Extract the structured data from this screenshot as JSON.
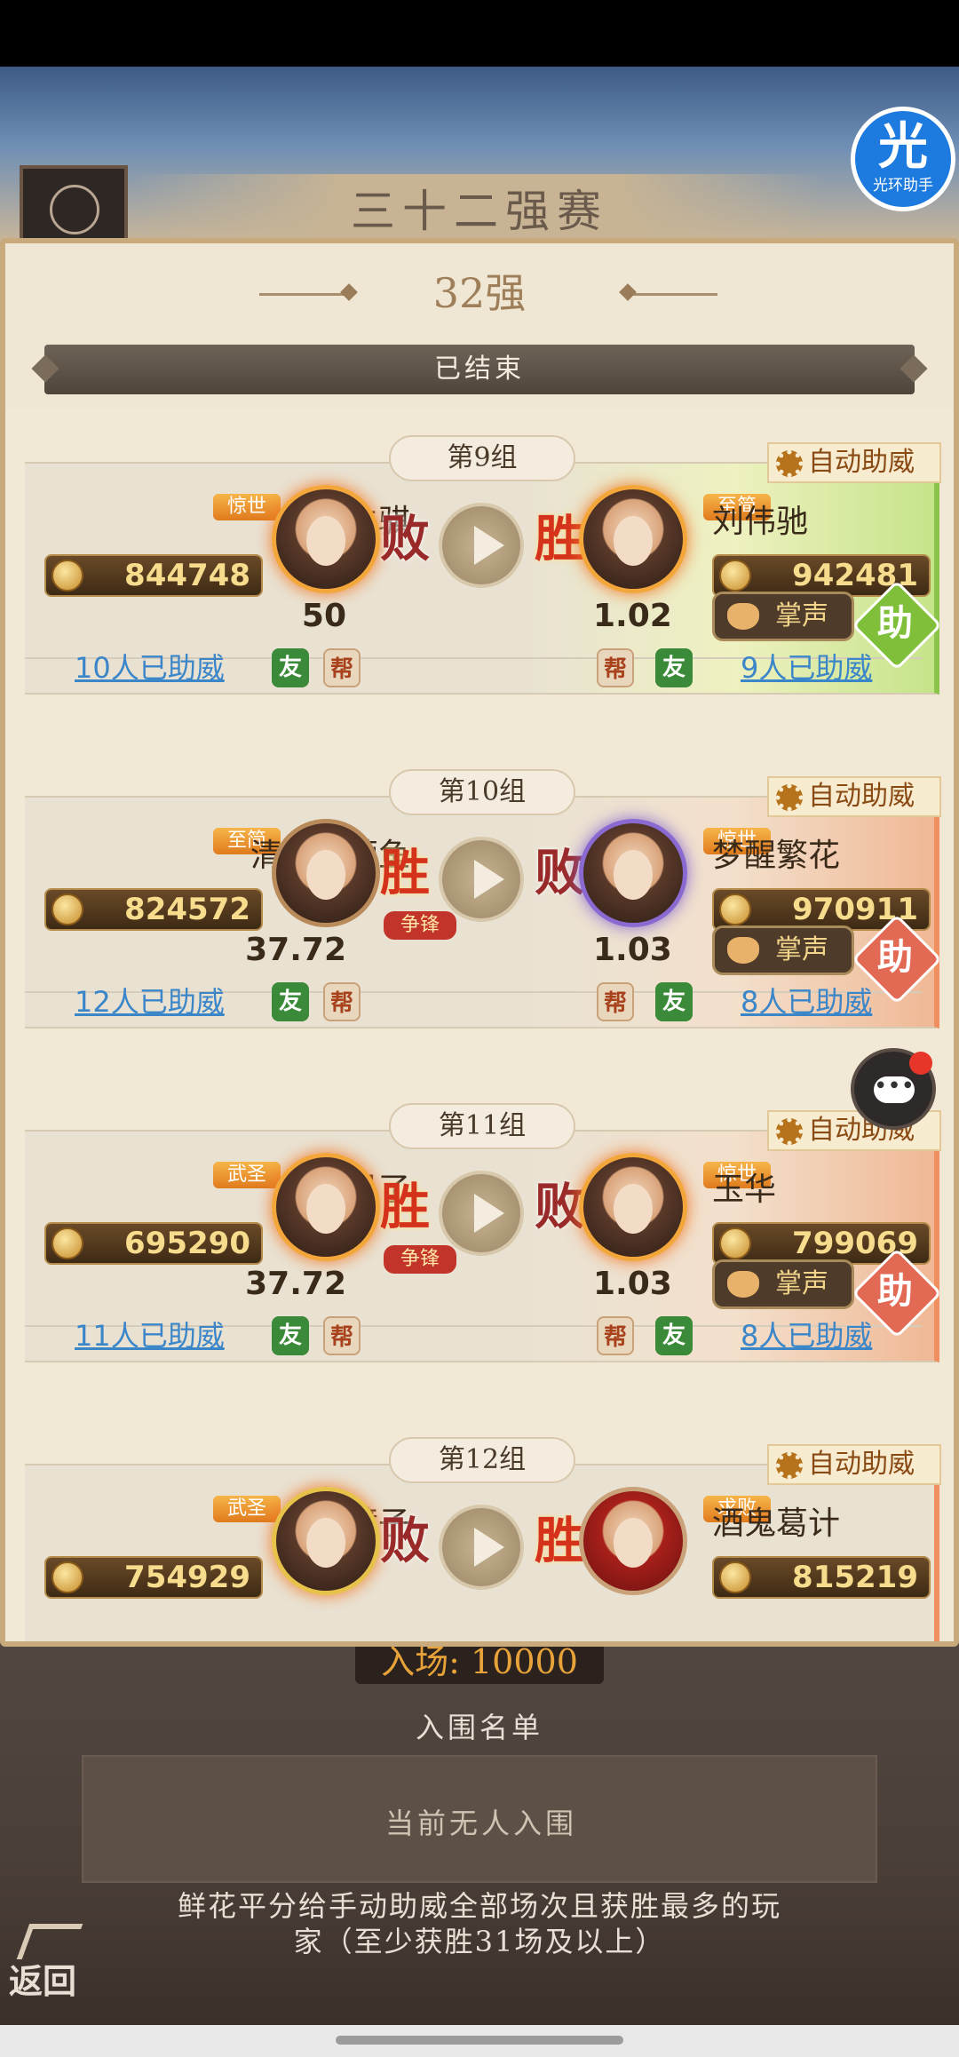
{
  "outer_title": "三十二强赛",
  "badge": {
    "big": "光",
    "small": "光环助手"
  },
  "round_title": "32强",
  "status": "已结束",
  "groups": [
    {
      "label": "第9组",
      "auto_assist": "自动助威",
      "left": {
        "title": "惊世",
        "name": "酒仙牛骐",
        "power": "844748",
        "result": "败",
        "odds": "50",
        "supporters": "10人已助威"
      },
      "right": {
        "title": "至简",
        "name": "刘伟驰",
        "power": "942481",
        "result": "胜",
        "odds": "1.02",
        "supporters": "9人已助威"
      },
      "applause": "掌声",
      "assist": "助"
    },
    {
      "label": "第10组",
      "auto_assist": "自动助威",
      "left": {
        "title": "至简",
        "name": "清花芙蓉鱼",
        "power": "824572",
        "result": "胜",
        "odds": "37.72",
        "supporters": "12人已助威"
      },
      "right": {
        "title": "惊世",
        "name": "梦醒繁花",
        "power": "970911",
        "result": "败",
        "odds": "1.03",
        "supporters": "8人已助威"
      },
      "vanguard": "争锋",
      "applause": "掌声",
      "assist": "助"
    },
    {
      "label": "第11组",
      "auto_assist": "自动助威",
      "left": {
        "title": "武圣",
        "name": "起风了",
        "power": "695290",
        "result": "胜",
        "odds": "37.72",
        "supporters": "11人已助威"
      },
      "right": {
        "title": "惊世",
        "name": "玉华",
        "power": "799069",
        "result": "败",
        "odds": "1.03",
        "supporters": "8人已助威"
      },
      "vanguard": "争锋",
      "applause": "掌声",
      "assist": "助"
    },
    {
      "label": "第12组",
      "auto_assist": "自动助威",
      "left": {
        "title": "武圣",
        "name": "冰镜子",
        "power": "754929",
        "result": "败"
      },
      "right": {
        "title": "求败",
        "name": "酒鬼葛计",
        "power": "815219",
        "result": "胜"
      }
    }
  ],
  "tags": {
    "friend": "友",
    "guild": "帮"
  },
  "entry_fee": "入场: 10000",
  "qualified_title": "入围名单",
  "qualified_empty": "当前无人入围",
  "rule_text": "鲜花平分给手动助威全部场次且获胜最多的玩家（至少获胜31场及以上）",
  "back_label": "返回",
  "colors": {
    "win_bar": "#8bc44a",
    "lose_bar": "#f09060",
    "accent": "#d5321c"
  }
}
